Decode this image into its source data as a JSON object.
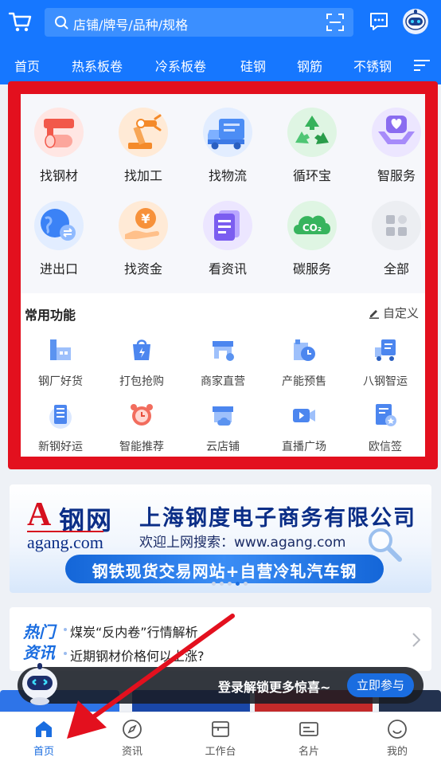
{
  "header": {
    "search_placeholder": "店铺/牌号/品种/规格",
    "category_tabs": [
      "首页",
      "热系板卷",
      "冷系板卷",
      "硅钢",
      "钢筋",
      "不锈钢"
    ]
  },
  "services": [
    {
      "label": "找钢材",
      "icon": "steel-roll-icon"
    },
    {
      "label": "找加工",
      "icon": "robot-arm-icon"
    },
    {
      "label": "找物流",
      "icon": "truck-icon"
    },
    {
      "label": "循环宝",
      "icon": "recycle-icon"
    },
    {
      "label": "智服务",
      "icon": "heart-hands-icon"
    },
    {
      "label": "进出口",
      "icon": "globe-exchange-icon"
    },
    {
      "label": "找资金",
      "icon": "yuan-coin-icon"
    },
    {
      "label": "看资讯",
      "icon": "document-icon"
    },
    {
      "label": "碳服务",
      "icon": "co2-cloud-icon"
    },
    {
      "label": "全部",
      "icon": "grid-icon"
    }
  ],
  "common_functions": {
    "title": "常用功能",
    "customize_label": "自定义",
    "items": [
      {
        "label": "钢厂好货",
        "icon": "factory-icon"
      },
      {
        "label": "打包抢购",
        "icon": "shopping-bag-icon"
      },
      {
        "label": "商家直营",
        "icon": "store-icon"
      },
      {
        "label": "产能预售",
        "icon": "capacity-clock-icon"
      },
      {
        "label": "八钢智运",
        "icon": "delivery-truck-icon"
      },
      {
        "label": "新钢好运",
        "icon": "server-icon"
      },
      {
        "label": "智能推荐",
        "icon": "alarm-clock-icon"
      },
      {
        "label": "云店铺",
        "icon": "cloud-store-icon"
      },
      {
        "label": "直播广场",
        "icon": "video-camera-icon"
      },
      {
        "label": "欧信签",
        "icon": "signature-badge-icon"
      }
    ]
  },
  "banner": {
    "logo_a": "A",
    "logo_cn": "钢网",
    "logo_en": "agang.com",
    "company": "上海钢度电子商务有限公司",
    "welcome": "欢迎上网搜索：www.agang.com",
    "slogan": "钢铁现货交易网站+自营冷轧汽车钢",
    "active_slide": 4,
    "slide_count": 5
  },
  "hot_news": {
    "badge_line1": "热门",
    "badge_line2": "资讯",
    "items": [
      "煤炭“反内卷”行情解析",
      "近期钢材价格何以上涨?"
    ]
  },
  "login_toast": {
    "text": "登录解锁更多惊喜~",
    "button": "立即参与"
  },
  "bottom_nav": [
    {
      "label": "首页",
      "icon": "home-icon",
      "active": true
    },
    {
      "label": "资讯",
      "icon": "compass-icon",
      "active": false
    },
    {
      "label": "工作台",
      "icon": "workbench-icon",
      "active": false
    },
    {
      "label": "名片",
      "icon": "card-icon",
      "active": false
    },
    {
      "label": "我的",
      "icon": "smile-icon",
      "active": false
    }
  ],
  "colors": {
    "primary": "#1677ff",
    "highlight_border": "#e3101e",
    "annotation_arrow": "#e3101e"
  }
}
